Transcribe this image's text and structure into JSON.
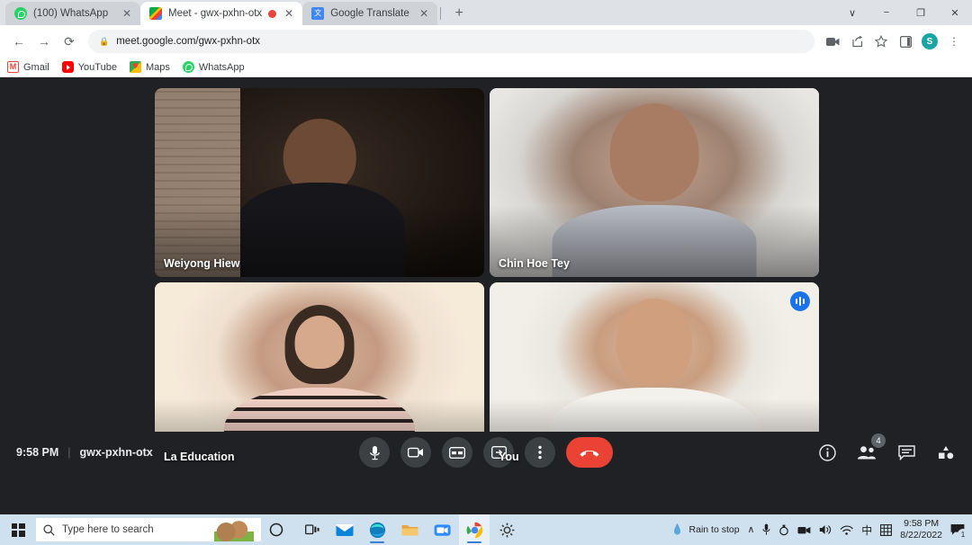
{
  "browser": {
    "tabs": [
      {
        "title": "(100) WhatsApp",
        "favicon": "whatsapp-icon",
        "active": false,
        "recording": false
      },
      {
        "title": "Meet - gwx-pxhn-otx",
        "favicon": "google-meet-icon",
        "active": true,
        "recording": true
      },
      {
        "title": "Google Translate",
        "favicon": "google-translate-icon",
        "active": false,
        "recording": false
      }
    ],
    "new_tab_label": "+",
    "window_controls": {
      "tab_search": "∨",
      "minimize": "−",
      "maximize": "❐",
      "close": "✕"
    },
    "nav": {
      "back": "←",
      "forward": "→",
      "reload": "⟳"
    },
    "omnibox": {
      "url": "meet.google.com/gwx-pxhn-otx",
      "lock": "🔒"
    },
    "toolbar_icons": [
      "camera-icon",
      "share-icon",
      "bookmark-star-icon",
      "side-panel-icon"
    ],
    "profile_initial": "S",
    "menu": "⋮",
    "bookmarks": [
      {
        "label": "Gmail",
        "icon": "gmail-icon"
      },
      {
        "label": "YouTube",
        "icon": "youtube-icon"
      },
      {
        "label": "Maps",
        "icon": "google-maps-icon"
      },
      {
        "label": "WhatsApp",
        "icon": "whatsapp-icon"
      }
    ]
  },
  "meet": {
    "participants": [
      {
        "name": "Weiyong Hiew",
        "active_speaker": false,
        "audio_indicator": false
      },
      {
        "name": "Chin Hoe Tey",
        "active_speaker": false,
        "audio_indicator": false
      },
      {
        "name": "La Education",
        "active_speaker": false,
        "audio_indicator": false
      },
      {
        "name": "You",
        "active_speaker": true,
        "audio_indicator": true
      }
    ],
    "status_time": "9:58 PM",
    "separator": "|",
    "meeting_code": "gwx-pxhn-otx",
    "controls": [
      {
        "name": "microphone-button",
        "glyph": "mic"
      },
      {
        "name": "camera-button",
        "glyph": "cam"
      },
      {
        "name": "captions-button",
        "glyph": "cc"
      },
      {
        "name": "present-screen-button",
        "glyph": "present"
      },
      {
        "name": "more-options-button",
        "glyph": "dots"
      },
      {
        "name": "hang-up-button",
        "glyph": "phone"
      }
    ],
    "right_controls": [
      {
        "name": "meeting-details-button",
        "glyph": "info",
        "badge": ""
      },
      {
        "name": "participants-button",
        "glyph": "people",
        "badge": "4"
      },
      {
        "name": "chat-button",
        "glyph": "chat",
        "badge": ""
      },
      {
        "name": "activities-button",
        "glyph": "activities",
        "badge": ""
      }
    ],
    "colors": {
      "stage_bg": "#202124",
      "active_border": "#4c8bf5",
      "hangup": "#ea4335",
      "audio_badge": "#1a73e8"
    }
  },
  "taskbar": {
    "search_placeholder": "Type here to search",
    "cortana": "○",
    "apps": [
      {
        "name": "task-view-icon"
      },
      {
        "name": "mail-icon"
      },
      {
        "name": "microsoft-edge-icon"
      },
      {
        "name": "file-explorer-icon"
      },
      {
        "name": "zoom-icon"
      },
      {
        "name": "google-chrome-icon"
      },
      {
        "name": "settings-gear-icon"
      }
    ],
    "weather": "Rain to stop",
    "tray": {
      "overflow": "∧",
      "ime": "中",
      "time": "9:58 PM",
      "date": "8/22/2022",
      "notification_count": "1"
    }
  }
}
